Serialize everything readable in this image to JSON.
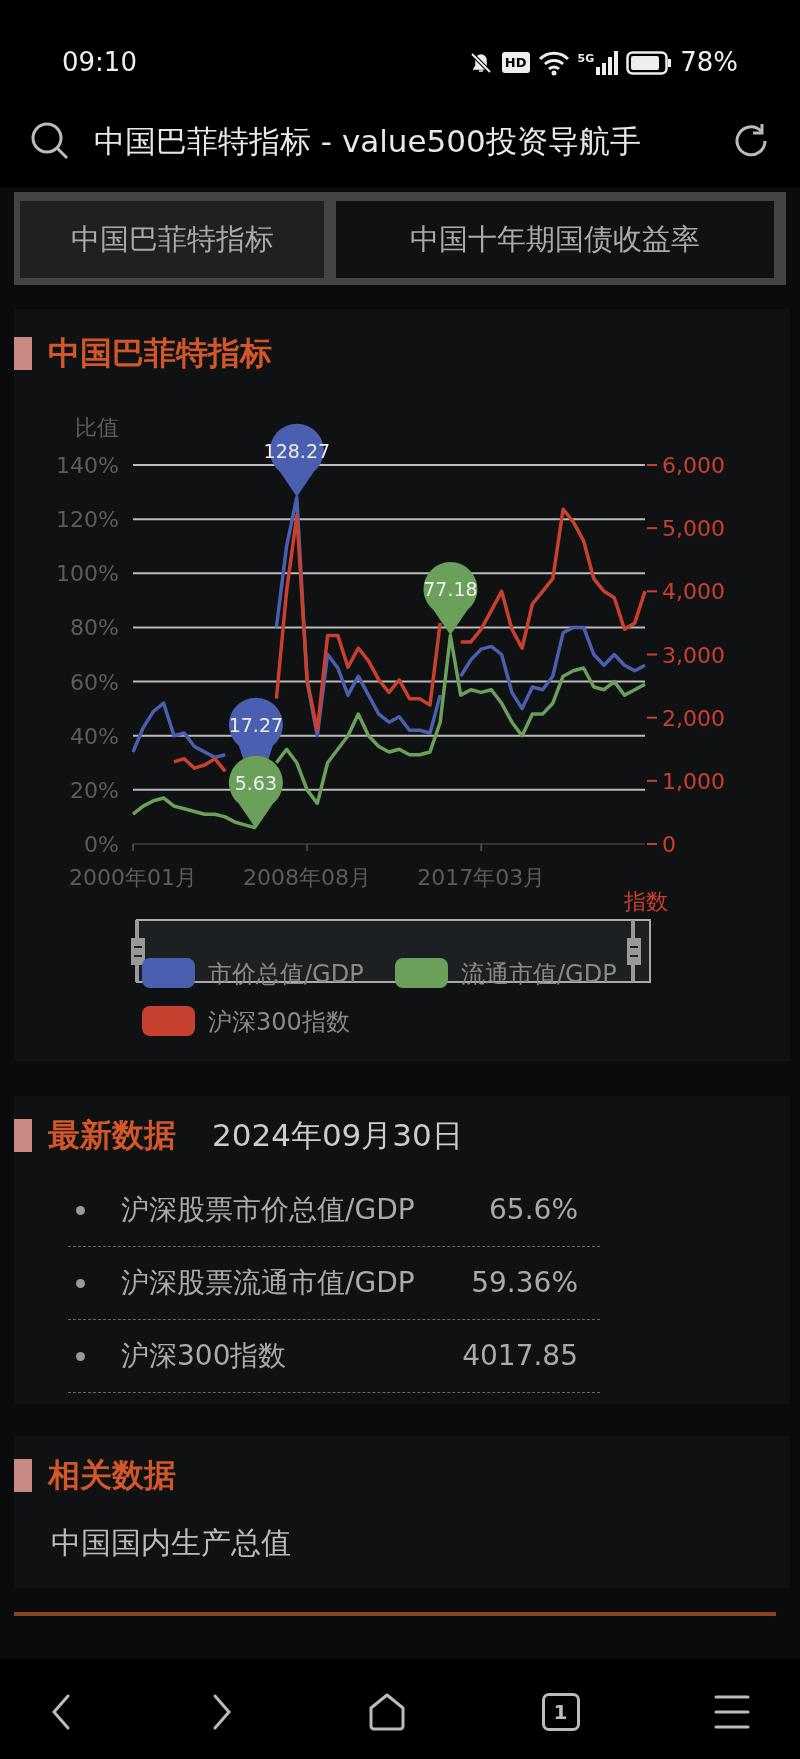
{
  "status_bar": {
    "time": "09:10",
    "hd_label": "HD",
    "network_label": "5G",
    "battery_text": "78%"
  },
  "address_bar": {
    "title": "中国巴菲特指标 - value500投资导航手"
  },
  "tabs": [
    {
      "label": "中国巴菲特指标",
      "selected": true
    },
    {
      "label": "中国十年期国债收益率",
      "selected": false
    }
  ],
  "chart_panel": {
    "title": "中国巴菲特指标",
    "chart_data": {
      "type": "line",
      "ylabel": "比值",
      "ylim": [
        0,
        140
      ],
      "grid": true,
      "legend": "bottom",
      "yticks": [
        {
          "value": 0,
          "label": "0%"
        },
        {
          "value": 20,
          "label": "20%"
        },
        {
          "value": 40,
          "label": "40%"
        },
        {
          "value": 60,
          "label": "60%"
        },
        {
          "value": 80,
          "label": "80%"
        },
        {
          "value": 100,
          "label": "100%"
        },
        {
          "value": 120,
          "label": "120%"
        },
        {
          "value": 140,
          "label": "140%"
        }
      ],
      "y2label": "指数",
      "y2lim": [
        0,
        6000
      ],
      "y2ticks": [
        {
          "value": 0,
          "label": "0"
        },
        {
          "value": 1000,
          "label": "1,000"
        },
        {
          "value": 2000,
          "label": "2,000"
        },
        {
          "value": 3000,
          "label": "3,000"
        },
        {
          "value": 4000,
          "label": "4,000"
        },
        {
          "value": 5000,
          "label": "5,000"
        },
        {
          "value": 6000,
          "label": "6,000"
        }
      ],
      "categories": [
        "2000年01月",
        null,
        null,
        null,
        null,
        null,
        null,
        null,
        null,
        null,
        null,
        null,
        null,
        null,
        null,
        null,
        null,
        "2008年08月",
        null,
        null,
        null,
        null,
        null,
        null,
        null,
        null,
        null,
        null,
        null,
        null,
        null,
        null,
        null,
        null,
        "2017年03月",
        null,
        null,
        null,
        null,
        null,
        null,
        null,
        null,
        null,
        null,
        null,
        null,
        null,
        null,
        null,
        null
      ],
      "series": [
        {
          "name": "市价总值/GDP",
          "color": "#4a5fb0",
          "values": [
            34,
            43,
            49,
            52,
            40,
            41,
            36,
            34,
            32,
            33,
            null,
            null,
            null,
            null,
            80,
            110,
            128,
            60,
            40,
            70,
            65,
            55,
            62,
            55,
            48,
            45,
            47,
            42,
            42,
            41,
            55,
            null,
            62,
            68,
            72,
            73,
            70,
            56,
            50,
            58,
            57,
            62,
            78,
            80,
            80,
            70,
            66,
            70,
            66,
            64,
            66
          ]
        },
        {
          "name": "流通市值/GDP",
          "color": "#6aa05a",
          "values": [
            11,
            14,
            16,
            17,
            14,
            13,
            12,
            11,
            11,
            10,
            8,
            7,
            6,
            null,
            30,
            35,
            30,
            20,
            15,
            30,
            35,
            40,
            48,
            40,
            36,
            34,
            35,
            33,
            33,
            34,
            45,
            77,
            55,
            57,
            56,
            57,
            52,
            45,
            40,
            48,
            48,
            52,
            62,
            64,
            65,
            58,
            57,
            60,
            55,
            57,
            59
          ]
        },
        {
          "name": "沪深300指数",
          "color": "#c8412f",
          "axis": "y2",
          "values": [
            null,
            null,
            null,
            null,
            1300,
            1350,
            1200,
            1250,
            1350,
            1150,
            null,
            null,
            null,
            null,
            2300,
            4000,
            5200,
            2600,
            1800,
            3300,
            3300,
            2800,
            3100,
            2900,
            2600,
            2400,
            2600,
            2300,
            2300,
            2200,
            3500,
            null,
            3200,
            3200,
            3400,
            3700,
            4000,
            3400,
            3100,
            3800,
            4000,
            4200,
            5300,
            5100,
            4800,
            4200,
            4000,
            3900,
            3400,
            3500,
            4000
          ]
        }
      ],
      "annotations": [
        "128.27",
        "17.27",
        "5.63",
        "77.18"
      ]
    }
  },
  "latest": {
    "title": "最新数据",
    "date": "2024年09月30日",
    "items": [
      {
        "label": "沪深股票市价总值/GDP",
        "value": "65.6%"
      },
      {
        "label": "沪深股票流通市值/GDP",
        "value": "59.36%"
      },
      {
        "label": "沪深300指数",
        "value": "4017.85"
      }
    ]
  },
  "related": {
    "title": "相关数据",
    "links": [
      "中国国内生产总值"
    ]
  },
  "bottom_nav": {
    "tab_count": "1"
  }
}
